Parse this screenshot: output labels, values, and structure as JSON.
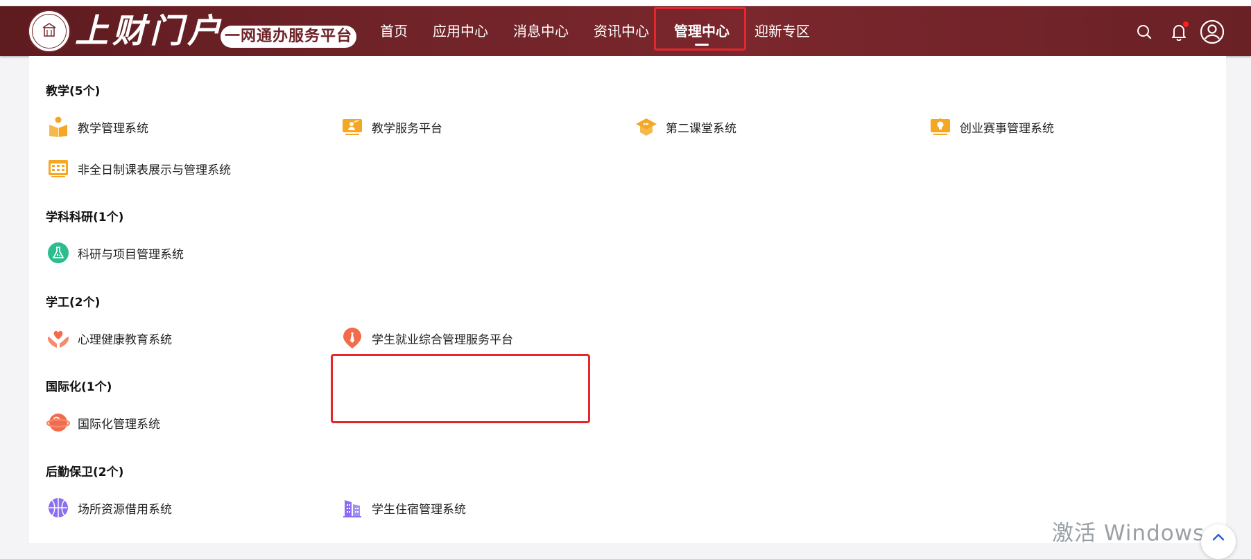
{
  "header": {
    "brand": "上财门户",
    "slogan": "一网通办服务平台",
    "nav": [
      {
        "label": "首页"
      },
      {
        "label": "应用中心"
      },
      {
        "label": "消息中心"
      },
      {
        "label": "资讯中心"
      },
      {
        "label": "管理中心",
        "active": true
      },
      {
        "label": "迎新专区"
      }
    ],
    "tools": {
      "search": "search-icon",
      "notifications": "bell-icon",
      "user": "user-icon"
    }
  },
  "sections": [
    {
      "title": "教学(5个)",
      "apps": [
        {
          "label": "教学管理系统",
          "icon": "book-reader-icon"
        },
        {
          "label": "教学服务平台",
          "icon": "teacher-board-icon"
        },
        {
          "label": "第二课堂系统",
          "icon": "graduation-cap-icon"
        },
        {
          "label": "创业赛事管理系统",
          "icon": "lightbulb-monitor-icon"
        },
        {
          "label": "非全日制课表展示与管理系统",
          "icon": "calendar-grid-icon"
        }
      ]
    },
    {
      "title": "学科科研(1个)",
      "apps": [
        {
          "label": "科研与项目管理系统",
          "icon": "flask-icon"
        }
      ]
    },
    {
      "title": "学工(2个)",
      "apps": [
        {
          "label": "心理健康教育系统",
          "icon": "heart-hands-icon"
        },
        {
          "label": "学生就业综合管理服务平台",
          "icon": "necktie-icon"
        }
      ]
    },
    {
      "title": "国际化(1个)",
      "apps": [
        {
          "label": "国际化管理系统",
          "icon": "globe-icon"
        }
      ]
    },
    {
      "title": "后勤保卫(2个)",
      "apps": [
        {
          "label": "场所资源借用系统",
          "icon": "basketball-icon"
        },
        {
          "label": "学生住宿管理系统",
          "icon": "dormitory-building-icon"
        }
      ]
    }
  ],
  "watermark": "激活 Windows",
  "colors": {
    "header": "#6f2328",
    "highlight": "#e5262a",
    "orange": "#f5a623",
    "green": "#2bbd8e",
    "coral": "#f26b4a",
    "purple": "#8b6ff0"
  }
}
